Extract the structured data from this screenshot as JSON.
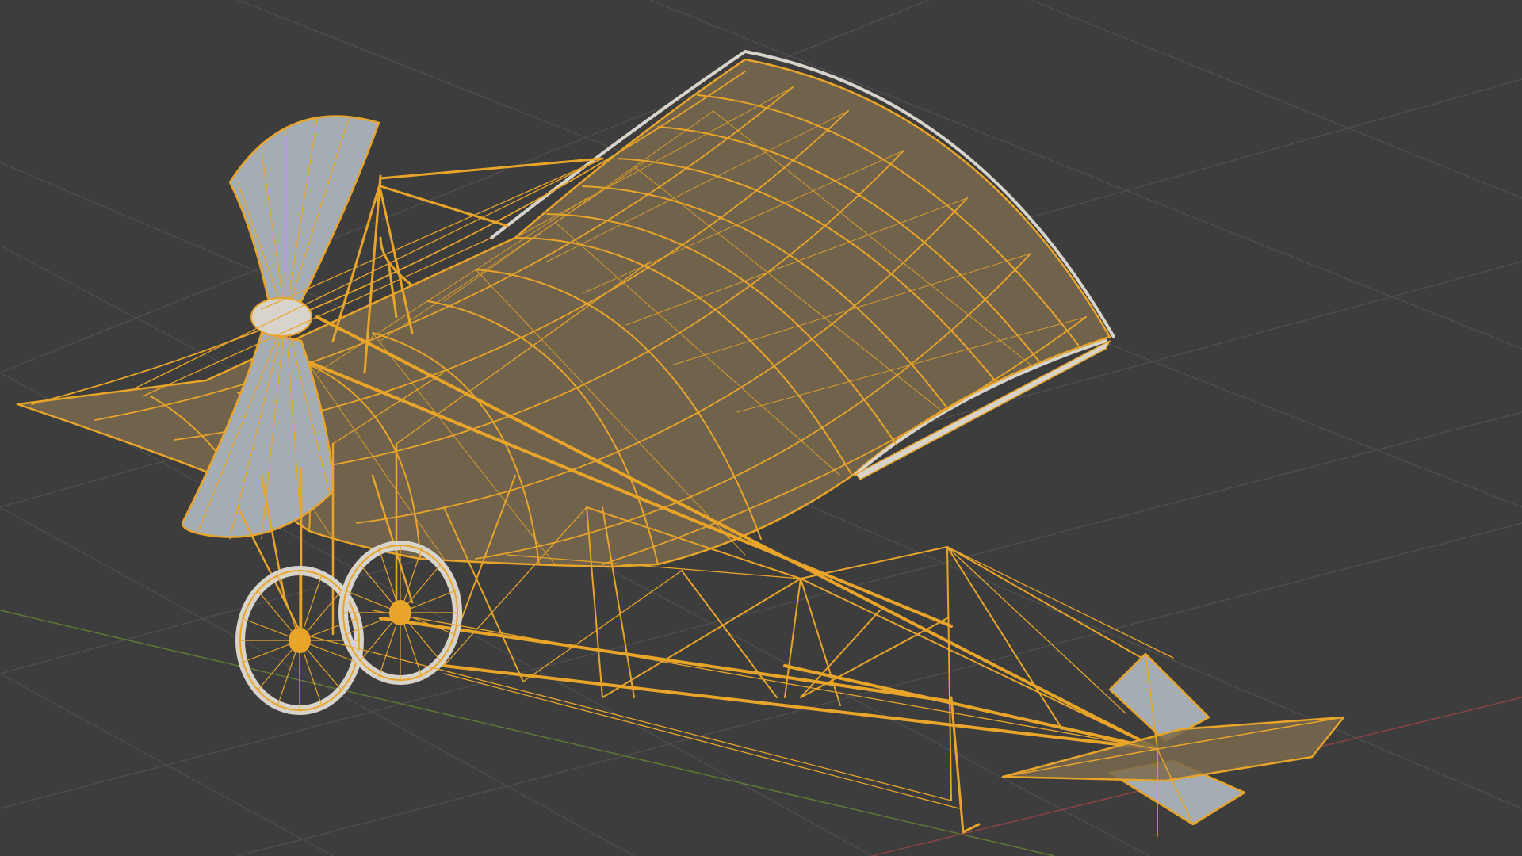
{
  "viewport": {
    "shading_mode": "wireframe",
    "object": "monoplane",
    "colors": {
      "background": "#3d3d3d",
      "grid_line": "#505050",
      "x_axis": "#8a4444",
      "y_axis": "#5d7a35",
      "selected_wire": "#e8a52a",
      "solid_surface": "#a4acb4",
      "fabric_surface": "#7a6a4e"
    }
  }
}
